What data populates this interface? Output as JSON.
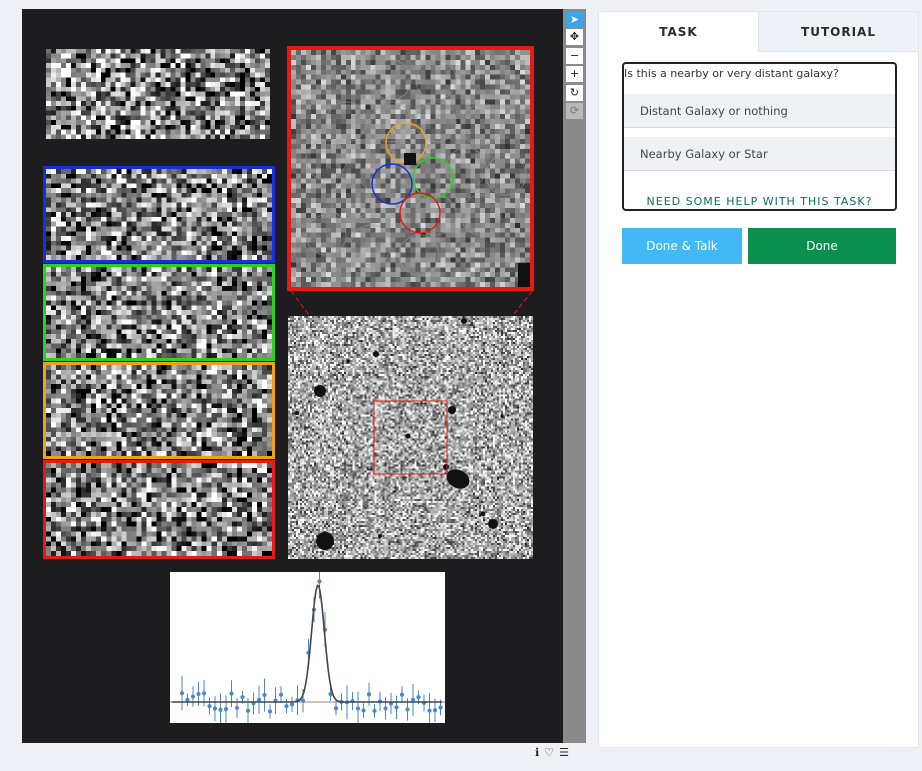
{
  "tabs": {
    "task": "TASK",
    "tutorial": "TUTORIAL"
  },
  "task": {
    "question": "Is this a nearby or very distant galaxy?",
    "answers": [
      "Distant Galaxy or nothing",
      "Nearby Galaxy or Star"
    ],
    "help": "NEED SOME HELP WITH THIS TASK?"
  },
  "buttons": {
    "done_talk": "Done & Talk",
    "done": "Done"
  },
  "toolbar_icons": [
    "pointer-icon",
    "move-icon",
    "minus-icon",
    "plus-icon",
    "rotate-icon",
    "reset-icon"
  ],
  "footer_icons": [
    "info-icon",
    "heart-icon",
    "list-icon"
  ],
  "colors": {
    "blue": "#1a2ee0",
    "green": "#2bd021",
    "orange": "#f0a020",
    "red": "#e51a14",
    "tab_inactive": "#eef1f5",
    "done_talk": "#43b9f4",
    "done": "#0a8f4f"
  }
}
